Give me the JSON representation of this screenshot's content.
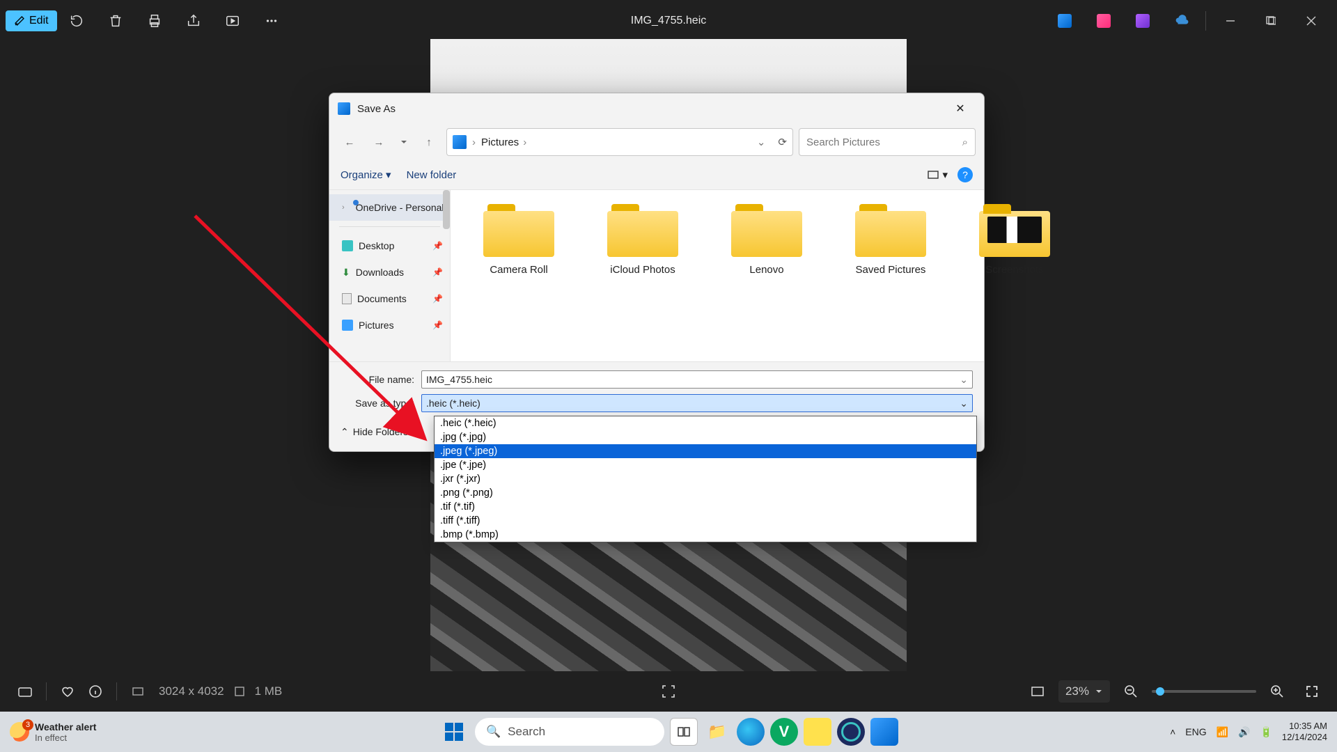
{
  "photos": {
    "edit_label": "Edit",
    "title": "IMG_4755.heic"
  },
  "status": {
    "dimensions": "3024 x 4032",
    "size": "1 MB",
    "zoom": "23%"
  },
  "dialog": {
    "title": "Save As",
    "breadcrumb": "Pictures",
    "search_placeholder": "Search Pictures",
    "organize": "Organize",
    "new_folder": "New folder",
    "sidebar": {
      "onedrive": "OneDrive - Personal",
      "desktop": "Desktop",
      "downloads": "Downloads",
      "documents": "Documents",
      "pictures": "Pictures"
    },
    "folders": [
      "Camera Roll",
      "iCloud Photos",
      "Lenovo",
      "Saved Pictures",
      "Screenshots"
    ],
    "filename_label": "File name:",
    "filename_value": "IMG_4755.heic",
    "type_label": "Save as type:",
    "type_value": ".heic (*.heic)",
    "type_options": [
      ".heic (*.heic)",
      ".jpg (*.jpg)",
      ".jpeg (*.jpeg)",
      ".jpe (*.jpe)",
      ".jxr (*.jxr)",
      ".png (*.png)",
      ".tif (*.tif)",
      ".tiff (*.tiff)",
      ".bmp (*.bmp)"
    ],
    "type_highlight_index": 2,
    "hide_folders": "Hide Folders"
  },
  "taskbar": {
    "weather_badge": "3",
    "weather_title": "Weather alert",
    "weather_sub": "In effect",
    "search_placeholder": "Search",
    "lang": "ENG",
    "time": "10:35 AM",
    "date": "12/14/2024"
  }
}
